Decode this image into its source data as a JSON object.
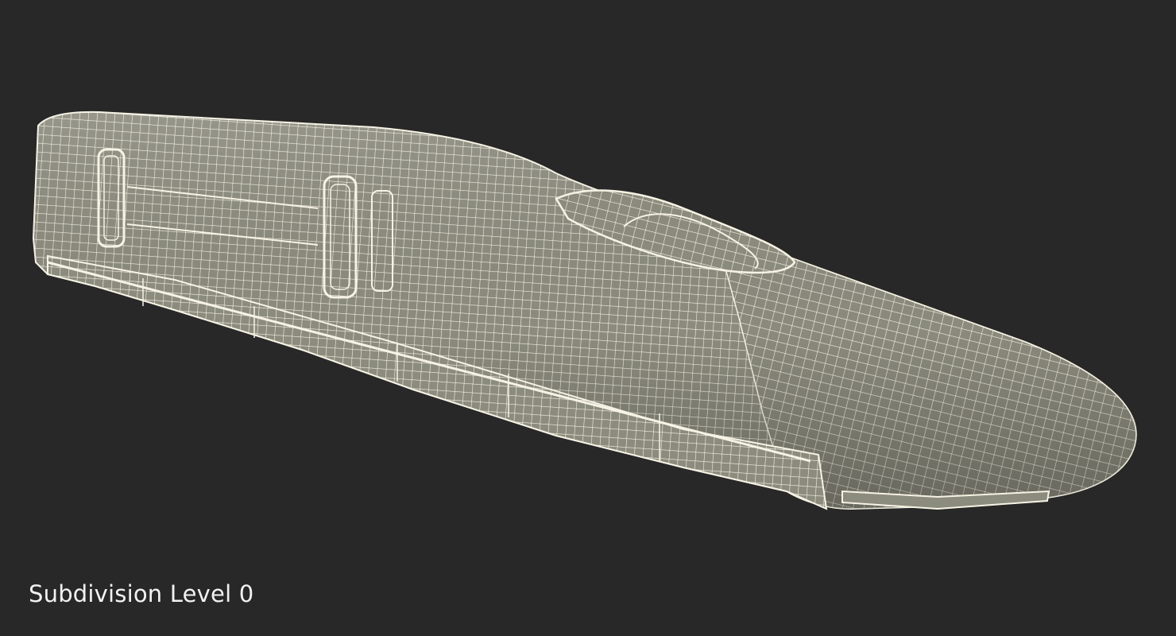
{
  "viewport": {
    "background_color": "#282828",
    "caption": "Subdivision Level 0"
  },
  "model": {
    "icon": "train-wireframe-icon",
    "surface_color": "#8b8b7e",
    "wire_color": "#f6f3e4"
  }
}
